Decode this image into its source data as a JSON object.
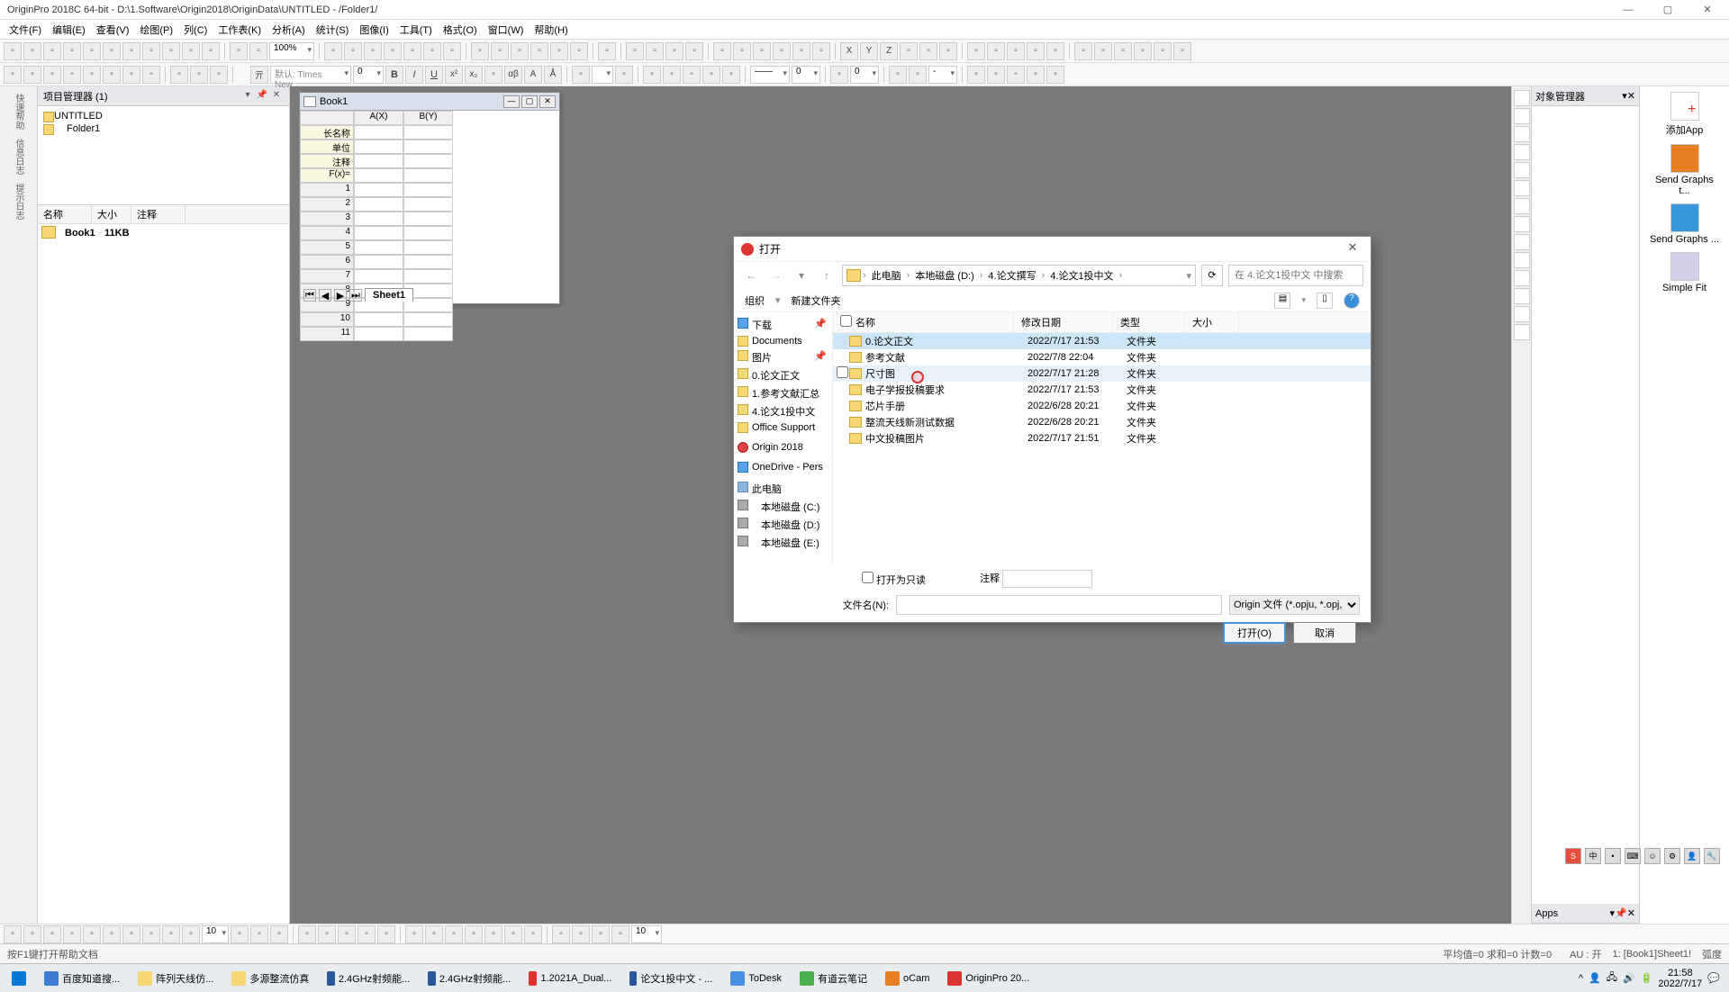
{
  "titlebar": {
    "text": "OriginPro 2018C 64-bit - D:\\1.Software\\Origin2018\\OriginData\\UNTITLED - /Folder1/"
  },
  "menu": {
    "file": "文件(F)",
    "edit": "编辑(E)",
    "view": "查看(V)",
    "plot": "绘图(P)",
    "col": "列(C)",
    "wks": "工作表(K)",
    "analysis": "分析(A)",
    "stats": "统计(S)",
    "image": "图像(I)",
    "tools": "工具(T)",
    "format": "格式(O)",
    "window": "窗口(W)",
    "help": "帮助(H)"
  },
  "toolbar": {
    "zoom": "100%",
    "font_prefix": "默认: Times New",
    "fontsize": "0",
    "size2": "0",
    "opt3": "0",
    "opt4": "-"
  },
  "pe": {
    "title": "项目管理器 (1)",
    "root": "UNTITLED",
    "folder": "Folder1",
    "cols": {
      "name": "名称",
      "size": "大小",
      "note": "注释"
    },
    "book": "Book1",
    "booksize": "11KB"
  },
  "leftlabels": {
    "a": "快速帮助",
    "b": "信息日志",
    "c": "提示日志"
  },
  "wb": {
    "title": "Book1",
    "ax": "A(X)",
    "by": "B(Y)",
    "longname": "长名称",
    "unit": "单位",
    "comment": "注释",
    "fx": "F(x)=",
    "sheet": "Sheet1"
  },
  "dlg": {
    "title": "打开",
    "bc": {
      "pc": "此电脑",
      "d": "本地磁盘 (D:)",
      "p1": "4.论文撰写",
      "p2": "4.论文1投中文"
    },
    "search_ph": "在 4.论文1投中文 中搜索",
    "organize": "组织",
    "newfolder": "新建文件夹",
    "sidebar": {
      "download": "下载",
      "documents": "Documents",
      "pictures": "图片",
      "s1": "0.论文正文",
      "s2": "1.参考文献汇总",
      "s3": "4.论文1投中文",
      "s4": "Office Support",
      "origin": "Origin 2018",
      "onedrive": "OneDrive - Pers",
      "thispc": "此电脑",
      "dc": "本地磁盘 (C:)",
      "dd": "本地磁盘 (D:)",
      "de": "本地磁盘 (E:)"
    },
    "cols": {
      "name": "名称",
      "date": "修改日期",
      "type": "类型",
      "size": "大小"
    },
    "files": [
      {
        "name": "0.论文正文",
        "date": "2022/7/17 21:53",
        "type": "文件夹"
      },
      {
        "name": "参考文献",
        "date": "2022/7/8 22:04",
        "type": "文件夹"
      },
      {
        "name": "尺寸图",
        "date": "2022/7/17 21:28",
        "type": "文件夹"
      },
      {
        "name": "电子学报投稿要求",
        "date": "2022/7/17 21:53",
        "type": "文件夹"
      },
      {
        "name": "芯片手册",
        "date": "2022/6/28 20:21",
        "type": "文件夹"
      },
      {
        "name": "整流天线新测试数据",
        "date": "2022/6/28 20:21",
        "type": "文件夹"
      },
      {
        "name": "中文投稿图片",
        "date": "2022/7/17 21:51",
        "type": "文件夹"
      }
    ],
    "open_readonly": "打开为只读",
    "note_lbl": "注释",
    "filename_lbl": "文件名(N):",
    "filter": "Origin 文件 (*.opju, *.opj, *.o",
    "open": "打开(O)",
    "cancel": "取消"
  },
  "obj": {
    "title": "对象管理器"
  },
  "apps": {
    "title": "Apps",
    "add": "添加App",
    "send1": "Send Graphs t...",
    "send2": "Send Graphs ...",
    "fit": "Simple Fit"
  },
  "status": {
    "hint": "按F1键打开帮助文档",
    "avg": "平均值=0 求和=0 计数=0",
    "au": "AU : 开",
    "sheet": "1: [Book1]Sheet1!",
    "deg": "弧度"
  },
  "task": {
    "baidu": "百度知道搜...",
    "t1": "阵列天线仿...",
    "t2": "多源整流仿真",
    "t3": "2.4GHz射频能...",
    "t4": "2.4GHz射频能...",
    "t5": "1.2021A_Dual...",
    "t6": "论文1投中文 - ...",
    "todesk": "ToDesk",
    "youdao": "有道云笔记",
    "ocam": "oCam",
    "origin": "OriginPro 20...",
    "time": "21:58",
    "date": "2022/7/17"
  },
  "btb": {
    "val": "10"
  },
  "tray": {
    "sogou": "S",
    "cn": "中"
  }
}
